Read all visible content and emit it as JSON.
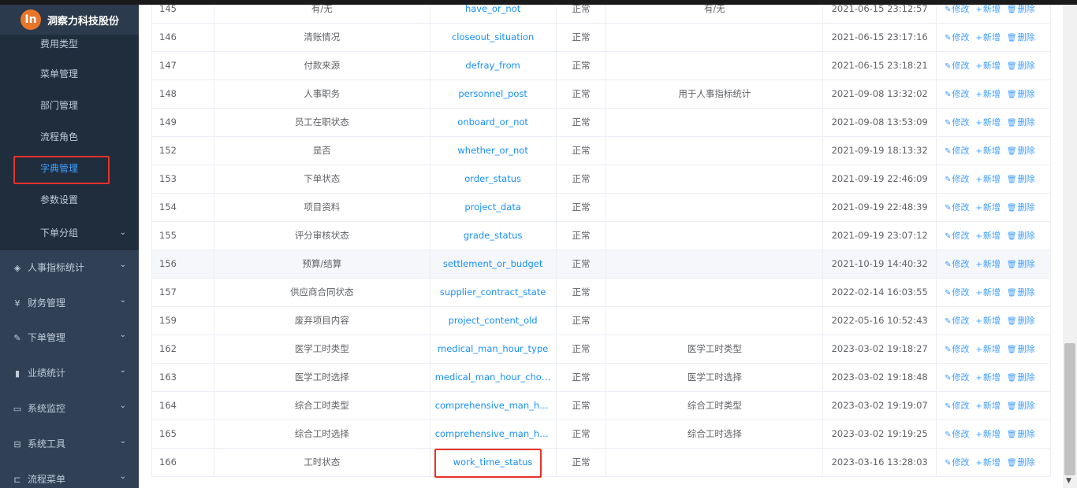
{
  "brand": {
    "logo_glyph": "In",
    "name": "洞察力科技股份"
  },
  "sidebar": {
    "submenu": [
      {
        "label": "费用类型",
        "active": false
      },
      {
        "label": "菜单管理",
        "active": false
      },
      {
        "label": "部门管理",
        "active": false
      },
      {
        "label": "流程角色",
        "active": false
      },
      {
        "label": "字典管理",
        "active": true
      },
      {
        "label": "参数设置",
        "active": false
      },
      {
        "label": "下单分组",
        "active": false
      }
    ],
    "menus": [
      {
        "label": "人事指标统计",
        "icon": "layers-icon"
      },
      {
        "label": "财务管理",
        "icon": "yen-icon"
      },
      {
        "label": "下单管理",
        "icon": "edit-icon"
      },
      {
        "label": "业绩统计",
        "icon": "bar-chart-icon"
      },
      {
        "label": "系统监控",
        "icon": "monitor-icon"
      },
      {
        "label": "系统工具",
        "icon": "toolbox-icon"
      },
      {
        "label": "流程菜单",
        "icon": "flow-icon"
      }
    ]
  },
  "ops": {
    "edit": "修改",
    "add": "新增",
    "delete": "删除"
  },
  "table": {
    "rows": [
      {
        "id": "145",
        "name": "有/无",
        "type": "have_or_not",
        "status": "正常",
        "remark": "有/无",
        "time": "2021-06-15 23:12:57"
      },
      {
        "id": "146",
        "name": "清账情况",
        "type": "closeout_situation",
        "status": "正常",
        "remark": "",
        "time": "2021-06-15 23:17:16"
      },
      {
        "id": "147",
        "name": "付款来源",
        "type": "defray_from",
        "status": "正常",
        "remark": "",
        "time": "2021-06-15 23:18:21"
      },
      {
        "id": "148",
        "name": "人事职务",
        "type": "personnel_post",
        "status": "正常",
        "remark": "用于人事指标统计",
        "time": "2021-09-08 13:32:02"
      },
      {
        "id": "149",
        "name": "员工在职状态",
        "type": "onboard_or_not",
        "status": "正常",
        "remark": "",
        "time": "2021-09-08 13:53:09"
      },
      {
        "id": "152",
        "name": "是否",
        "type": "whether_or_not",
        "status": "正常",
        "remark": "",
        "time": "2021-09-19 18:13:32"
      },
      {
        "id": "153",
        "name": "下单状态",
        "type": "order_status",
        "status": "正常",
        "remark": "",
        "time": "2021-09-19 22:46:09"
      },
      {
        "id": "154",
        "name": "项目资料",
        "type": "project_data",
        "status": "正常",
        "remark": "",
        "time": "2021-09-19 22:48:39"
      },
      {
        "id": "155",
        "name": "评分审核状态",
        "type": "grade_status",
        "status": "正常",
        "remark": "",
        "time": "2021-09-19 23:07:12"
      },
      {
        "id": "156",
        "name": "预算/结算",
        "type": "settlement_or_budget",
        "status": "正常",
        "remark": "",
        "time": "2021-10-19 14:40:32"
      },
      {
        "id": "157",
        "name": "供应商合同状态",
        "type": "supplier_contract_state",
        "status": "正常",
        "remark": "",
        "time": "2022-02-14 16:03:55"
      },
      {
        "id": "159",
        "name": "废弃项目内容",
        "type": "project_content_old",
        "status": "正常",
        "remark": "",
        "time": "2022-05-16 10:52:43"
      },
      {
        "id": "162",
        "name": "医学工时类型",
        "type": "medical_man_hour_type",
        "status": "正常",
        "remark": "医学工时类型",
        "time": "2023-03-02 19:18:27"
      },
      {
        "id": "163",
        "name": "医学工时选择",
        "type": "medical_man_hour_choice",
        "status": "正常",
        "remark": "医学工时选择",
        "time": "2023-03-02 19:18:48"
      },
      {
        "id": "164",
        "name": "综合工时类型",
        "type": "comprehensive_man_hour...",
        "status": "正常",
        "remark": "综合工时类型",
        "time": "2023-03-02 19:19:07"
      },
      {
        "id": "165",
        "name": "综合工时选择",
        "type": "comprehensive_man_hour...",
        "status": "正常",
        "remark": "综合工时选择",
        "time": "2023-03-02 19:19:25"
      },
      {
        "id": "166",
        "name": "工时状态",
        "type": "work_time_status",
        "status": "正常",
        "remark": "",
        "time": "2023-03-16 13:28:03"
      }
    ]
  },
  "colors": {
    "sidebar_bg": "#304156",
    "submenu_bg": "#1f2d3d",
    "link": "#409eff",
    "highlight_border": "#e8312a"
  }
}
